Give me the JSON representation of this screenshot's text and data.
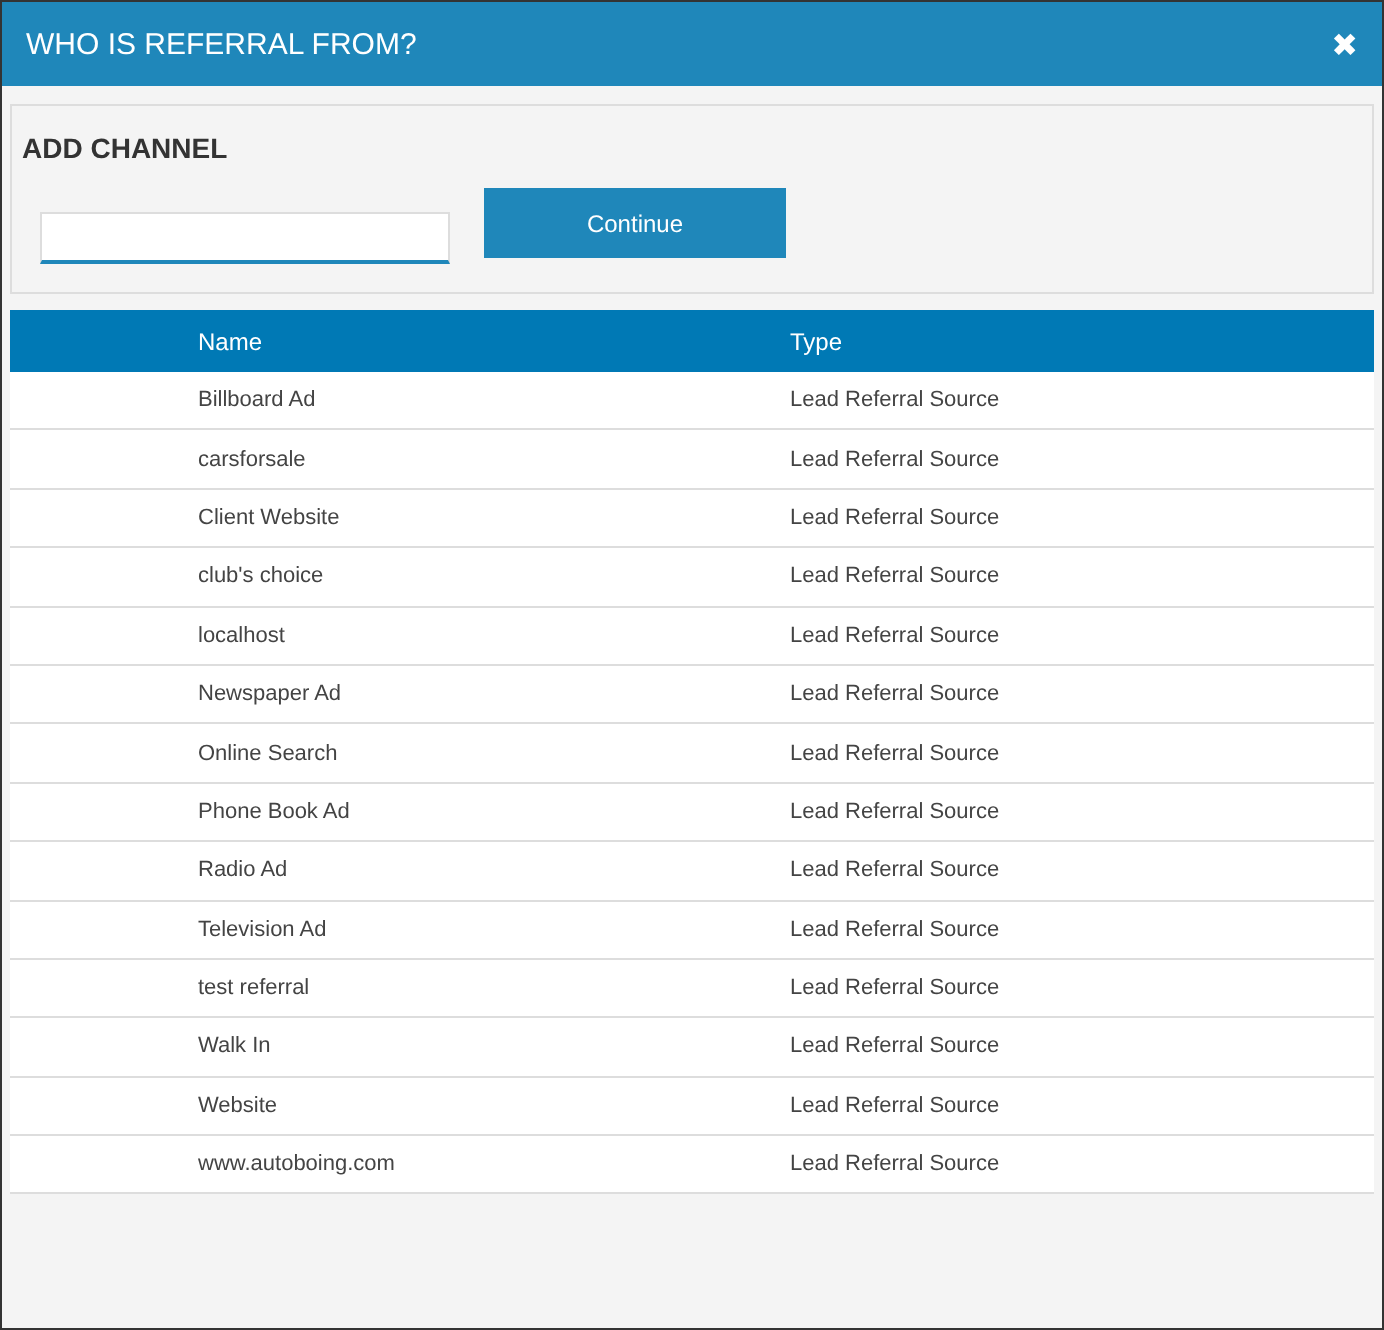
{
  "dialog": {
    "title": "WHO IS REFERRAL FROM?",
    "close": "✖"
  },
  "add_channel": {
    "heading": "ADD CHANNEL",
    "button": "Continue"
  },
  "table": {
    "columns": [
      "Name",
      "Type"
    ],
    "rows": [
      {
        "name": "Billboard Ad",
        "type": "Lead Referral Source"
      },
      {
        "name": "carsforsale",
        "type": "Lead Referral Source"
      },
      {
        "name": "Client Website",
        "type": "Lead Referral Source"
      },
      {
        "name": "club's choice",
        "type": "Lead Referral Source"
      },
      {
        "name": "localhost",
        "type": "Lead Referral Source"
      },
      {
        "name": "Newspaper Ad",
        "type": "Lead Referral Source"
      },
      {
        "name": "Online Search",
        "type": "Lead Referral Source"
      },
      {
        "name": "Phone Book Ad",
        "type": "Lead Referral Source"
      },
      {
        "name": "Radio Ad",
        "type": "Lead Referral Source"
      },
      {
        "name": "Television Ad",
        "type": "Lead Referral Source"
      },
      {
        "name": "test referral",
        "type": "Lead Referral Source"
      },
      {
        "name": "Walk In",
        "type": "Lead Referral Source"
      },
      {
        "name": "Website",
        "type": "Lead Referral Source"
      },
      {
        "name": "www.autoboing.com",
        "type": "Lead Referral Source"
      }
    ]
  }
}
